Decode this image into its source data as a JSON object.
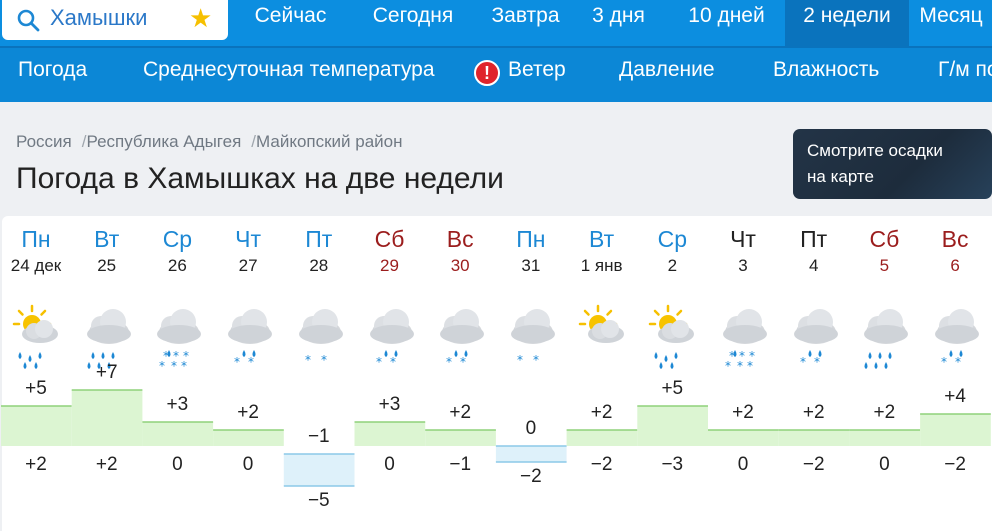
{
  "search": {
    "value": "Хамышки"
  },
  "nav": {
    "tabs": [
      {
        "label": "Сейчас"
      },
      {
        "label": "Сегодня"
      },
      {
        "label": "Завтра"
      },
      {
        "label": "3 дня"
      },
      {
        "label": "10 дней"
      },
      {
        "label": "2 недели"
      },
      {
        "label": "Месяц"
      }
    ],
    "active": "2 недели"
  },
  "subnav": {
    "tabs": [
      {
        "label": "Погода"
      },
      {
        "label": "Среднесуточная температура"
      },
      {
        "label": "Ветер"
      },
      {
        "label": "Давление"
      },
      {
        "label": "Влажность"
      },
      {
        "label": "Г/м поле"
      }
    ],
    "warning_mark": "!"
  },
  "breadcrumb": [
    "Россия",
    "Республика Адыгея",
    "Майкопский район"
  ],
  "page_title": "Погода в Хамышках на две недели",
  "promo": {
    "line1": "Смотрите осадки",
    "line2": "на карте"
  },
  "colors": {
    "accent": "#0c8ee0",
    "weekday": "#1d88d4",
    "weekend": "#9b1d1d",
    "warm": "#dcf5d2",
    "cold": "#def1fa"
  },
  "forecast": {
    "days": [
      {
        "name": "Пн",
        "date": "24 дек",
        "type": "weekday",
        "icon": "sun-cloud-rain-icon",
        "max": "+5",
        "min": "+2",
        "maxv": 5,
        "minv": 2
      },
      {
        "name": "Вт",
        "date": "25",
        "type": "weekday",
        "icon": "cloud-rain-icon",
        "max": "+7",
        "min": "+2",
        "maxv": 7,
        "minv": 2
      },
      {
        "name": "Ср",
        "date": "26",
        "type": "weekday",
        "icon": "cloud-snow-icon",
        "max": "+3",
        "min": "0",
        "maxv": 3,
        "minv": 0
      },
      {
        "name": "Чт",
        "date": "27",
        "type": "weekday",
        "icon": "cloud-sleet-icon",
        "max": "+2",
        "min": "0",
        "maxv": 2,
        "minv": 0
      },
      {
        "name": "Пт",
        "date": "28",
        "type": "weekday",
        "icon": "cloud-snow-light-icon",
        "max": "−1",
        "min": "−5",
        "maxv": -1,
        "minv": -5
      },
      {
        "name": "Сб",
        "date": "29",
        "type": "weekend",
        "icon": "cloud-sleet-icon",
        "max": "+3",
        "min": "0",
        "maxv": 3,
        "minv": 0
      },
      {
        "name": "Вс",
        "date": "30",
        "type": "weekend",
        "icon": "cloud-sleet-icon",
        "max": "+2",
        "min": "−1",
        "maxv": 2,
        "minv": -1
      },
      {
        "name": "Пн",
        "date": "31",
        "type": "weekday",
        "icon": "cloud-snow-light-icon",
        "max": "0",
        "min": "−2",
        "maxv": 0,
        "minv": -2
      },
      {
        "name": "Вт",
        "date": "1 янв",
        "type": "weekday",
        "icon": "sun-cloud-icon",
        "max": "+2",
        "min": "−2",
        "maxv": 2,
        "minv": -2
      },
      {
        "name": "Ср",
        "date": "2",
        "type": "weekday",
        "icon": "sun-cloud-rain-icon",
        "max": "+5",
        "min": "−3",
        "maxv": 5,
        "minv": -3
      },
      {
        "name": "Чт",
        "date": "3",
        "type": "plain",
        "icon": "cloud-snow-icon",
        "max": "+2",
        "min": "0",
        "maxv": 2,
        "minv": 0
      },
      {
        "name": "Пт",
        "date": "4",
        "type": "plain",
        "icon": "cloud-sleet-icon",
        "max": "+2",
        "min": "−2",
        "maxv": 2,
        "minv": -2
      },
      {
        "name": "Сб",
        "date": "5",
        "type": "weekend",
        "icon": "cloud-rain-icon",
        "max": "+2",
        "min": "0",
        "maxv": 2,
        "minv": 0
      },
      {
        "name": "Вс",
        "date": "6",
        "type": "weekend",
        "icon": "cloud-sleet-icon",
        "max": "+4",
        "min": "−2",
        "maxv": 4,
        "minv": -2
      }
    ]
  }
}
